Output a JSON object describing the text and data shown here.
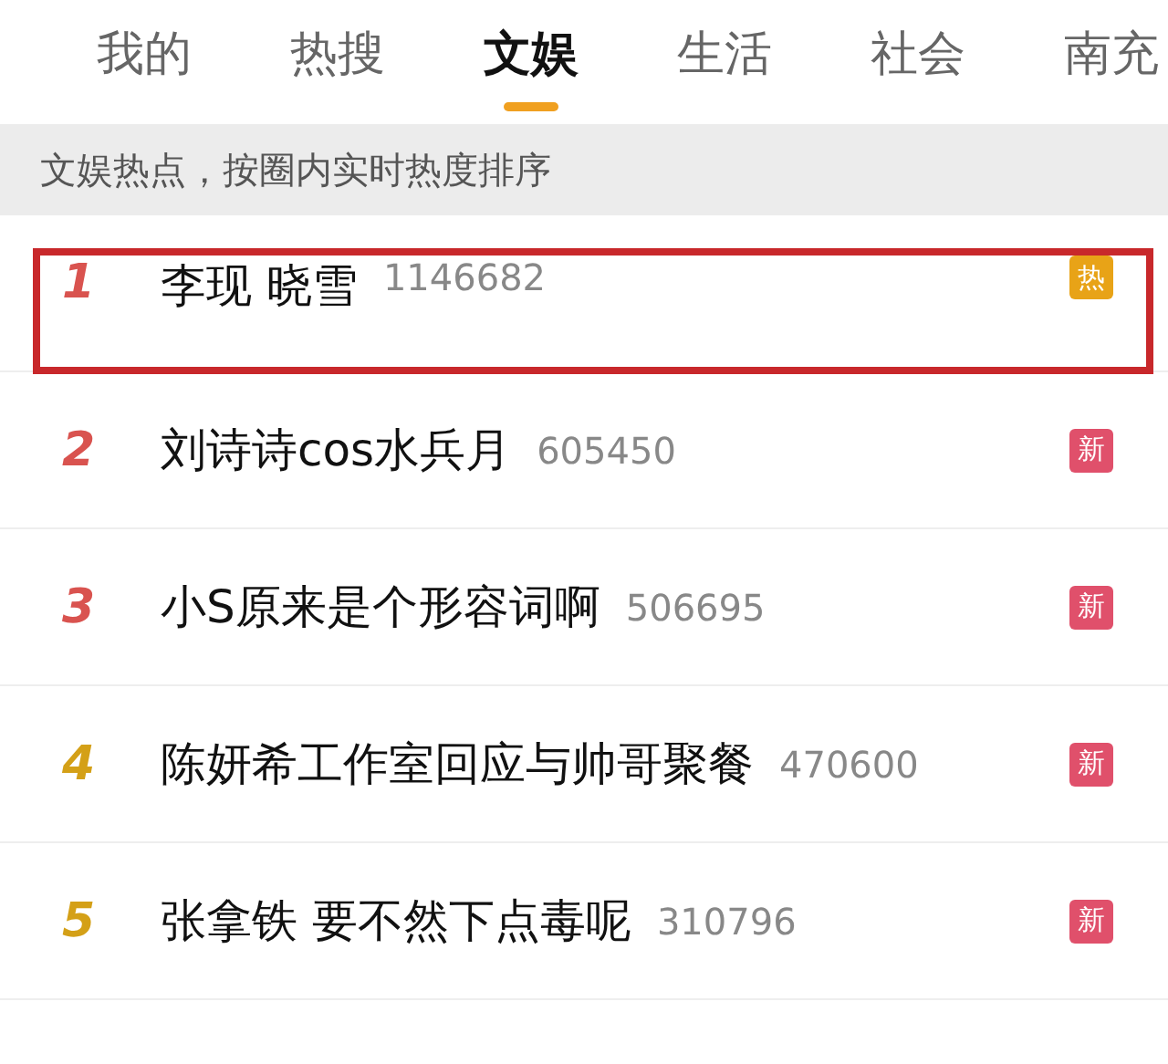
{
  "tabs": [
    {
      "label": "我的",
      "selected": false
    },
    {
      "label": "热搜",
      "selected": false
    },
    {
      "label": "文娱",
      "selected": true
    },
    {
      "label": "生活",
      "selected": false
    },
    {
      "label": "社会",
      "selected": false
    },
    {
      "label": "南充",
      "selected": false
    }
  ],
  "notice": "文娱热点，按圈内实时热度排序",
  "rows": [
    {
      "rank": "1",
      "color": "#d9534f",
      "title": "李现 晓雪",
      "count": "1146682",
      "badge": {
        "kind": "hot",
        "text": "热"
      },
      "highlighted": true
    },
    {
      "rank": "2",
      "color": "#d9534f",
      "title": "刘诗诗cos水兵月",
      "count": "605450",
      "badge": {
        "kind": "new",
        "text": "新"
      },
      "highlighted": false
    },
    {
      "rank": "3",
      "color": "#d9534f",
      "title": "小S原来是个形容词啊",
      "count": "506695",
      "badge": {
        "kind": "new",
        "text": "新"
      },
      "highlighted": false
    },
    {
      "rank": "4",
      "color": "#d4a017",
      "title": "陈妍希工作室回应与帅哥聚餐",
      "count": "470600",
      "badge": {
        "kind": "new",
        "text": "新"
      },
      "highlighted": false
    },
    {
      "rank": "5",
      "color": "#d4a017",
      "title": "张拿铁 要不然下点毒呢",
      "count": "310796",
      "badge": {
        "kind": "new",
        "text": "新"
      },
      "highlighted": false
    }
  ]
}
